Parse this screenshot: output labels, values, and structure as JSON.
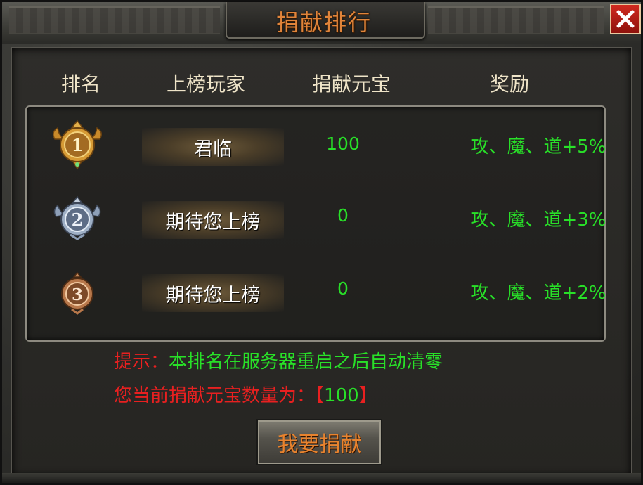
{
  "window": {
    "title": "捐献排行",
    "close_icon": "close-icon"
  },
  "table": {
    "headers": [
      "排名",
      "上榜玩家",
      "捐献元宝",
      "奖励"
    ],
    "rows": [
      {
        "rank": "1",
        "player": "君临",
        "amount": "100",
        "reward": "攻、魔、道+5%",
        "medal": "gold"
      },
      {
        "rank": "2",
        "player": "期待您上榜",
        "amount": "0",
        "reward": "攻、魔、道+3%",
        "medal": "silver"
      },
      {
        "rank": "3",
        "player": "期待您上榜",
        "amount": "0",
        "reward": "攻、魔、道+2%",
        "medal": "bronze"
      }
    ]
  },
  "footer": {
    "tip_label": "提示：",
    "tip_text": "本排名在服务器重启之后自动清零",
    "donated_label": "您当前捐献元宝数量为：",
    "donated_open": "【",
    "donated_value": "100",
    "donated_close": "】",
    "donate_button": "我要捐献"
  },
  "colors": {
    "title": "#e0843a",
    "green": "#28e028",
    "red": "#e82020",
    "header": "#efe4c8"
  }
}
